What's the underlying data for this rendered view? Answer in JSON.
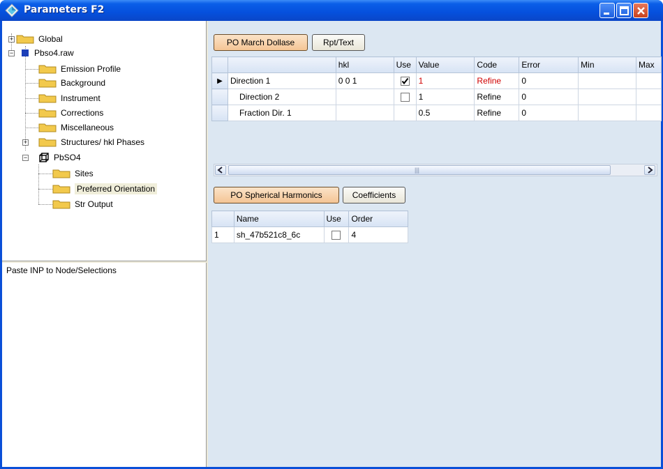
{
  "window": {
    "title": "Parameters F2"
  },
  "tree": {
    "items": [
      {
        "label": "Global"
      },
      {
        "label": "Pbso4.raw"
      },
      {
        "label": "Emission Profile"
      },
      {
        "label": "Background"
      },
      {
        "label": "Instrument"
      },
      {
        "label": "Corrections"
      },
      {
        "label": "Miscellaneous"
      },
      {
        "label": "Structures/ hkl Phases"
      },
      {
        "label": "PbSO4"
      },
      {
        "label": "Sites"
      },
      {
        "label": "Preferred Orientation"
      },
      {
        "label": "Str Output"
      }
    ],
    "expanders": {
      "plus": "+",
      "minus": "−"
    }
  },
  "bottom_panel": {
    "label": "Paste INP to Node/Selections"
  },
  "po_march": {
    "tabs": [
      {
        "label": "PO March Dollase"
      },
      {
        "label": "Rpt/Text"
      }
    ],
    "columns": [
      "hkl",
      "Use",
      "Value",
      "Code",
      "Error",
      "Min",
      "Max"
    ],
    "rows": [
      {
        "name": "Direction 1",
        "hkl": "0 0 1",
        "use": true,
        "value": "1",
        "code": "Refine",
        "error": "0"
      },
      {
        "name": "Direction 2",
        "hkl": "",
        "use": false,
        "value": "1",
        "code": "Refine",
        "error": "0"
      },
      {
        "name": "Fraction Dir. 1",
        "hkl": "",
        "use": null,
        "value": "0.5",
        "code": "Refine",
        "error": "0"
      }
    ],
    "current_row_marker": "▶",
    "scroll_grip": "|||"
  },
  "po_spherical": {
    "tabs": [
      {
        "label": "PO Spherical Harmonics"
      },
      {
        "label": "Coefficients"
      }
    ],
    "columns": [
      "Name",
      "Use",
      "Order"
    ],
    "rows": [
      {
        "index": "1",
        "name": "sh_47b521c8_6c",
        "use": false,
        "order": "4"
      }
    ]
  },
  "colors": {
    "titlebar": "#0550dd",
    "client_bg": "#ece9d8",
    "right_bg": "#dce7f2",
    "active_tab": "#f4c595",
    "red_text": "#d00000"
  }
}
